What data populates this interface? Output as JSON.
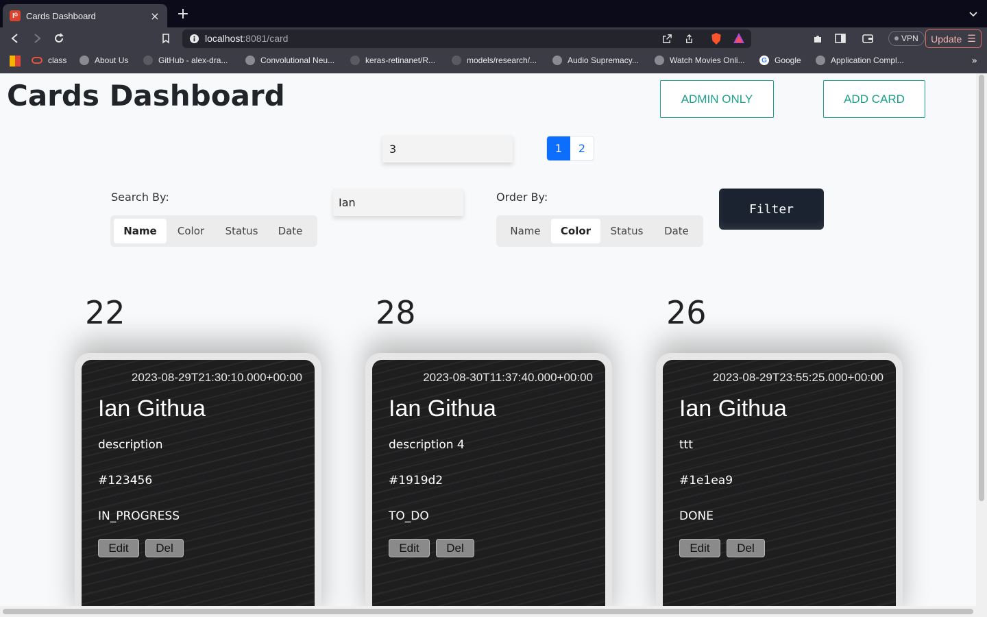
{
  "browser": {
    "tab_title": "Cards Dashboard",
    "tab_favicon": "Iᴳ",
    "new_tab": "+",
    "tab_close": "×",
    "url_host": "localhost",
    "url_path": ":8081/card",
    "vpn_label": "VPN",
    "update_label": "Update",
    "bookmarks": [
      {
        "label": "class",
        "icon": "cloud-icon"
      },
      {
        "label": "About Us",
        "icon": "globe-icon"
      },
      {
        "label": "GitHub - alex-dra...",
        "icon": "github-icon"
      },
      {
        "label": "Convolutional Neu...",
        "icon": "globe-icon"
      },
      {
        "label": "keras-retinanet/R...",
        "icon": "github-icon"
      },
      {
        "label": "models/research/...",
        "icon": "github-icon"
      },
      {
        "label": "Audio Supremacy...",
        "icon": "globe-icon"
      },
      {
        "label": "Watch Movies Onli...",
        "icon": "globe-icon"
      },
      {
        "label": "Google",
        "icon": "google-icon"
      },
      {
        "label": "Application Compl...",
        "icon": "globe-icon"
      }
    ],
    "bookmarks_more": "»"
  },
  "page": {
    "title": "Cards Dashboard",
    "admin_only_label": "ADMIN ONLY",
    "add_card_label": "ADD CARD",
    "page_size_value": "3",
    "pagination": [
      "1",
      "2"
    ],
    "active_page": "1",
    "search_by_label": "Search By:",
    "search_by_options": [
      "Name",
      "Color",
      "Status",
      "Date"
    ],
    "search_by_selected": "Name",
    "search_value": "Ian",
    "order_by_label": "Order By:",
    "order_by_options": [
      "Name",
      "Color",
      "Status",
      "Date"
    ],
    "order_by_selected": "Color",
    "filter_label": "Filter"
  },
  "cards": [
    {
      "id": "22",
      "date": "2023-08-29T21:30:10.000+00:00",
      "name": "Ian Githua",
      "description": "description",
      "color": "#123456",
      "status": "IN_PROGRESS",
      "edit_label": "Edit",
      "del_label": "Del"
    },
    {
      "id": "28",
      "date": "2023-08-30T11:37:40.000+00:00",
      "name": "Ian Githua",
      "description": "description 4",
      "color": "#1919d2",
      "status": "TO_DO",
      "edit_label": "Edit",
      "del_label": "Del"
    },
    {
      "id": "26",
      "date": "2023-08-29T23:55:25.000+00:00",
      "name": "Ian Githua",
      "description": "ttt",
      "color": "#1e1ea9",
      "status": "DONE",
      "edit_label": "Edit",
      "del_label": "Del"
    }
  ],
  "colors": {
    "accent_teal": "#1aa08a",
    "pager_blue": "#0d6efd",
    "filter_button": "#1b2330"
  }
}
